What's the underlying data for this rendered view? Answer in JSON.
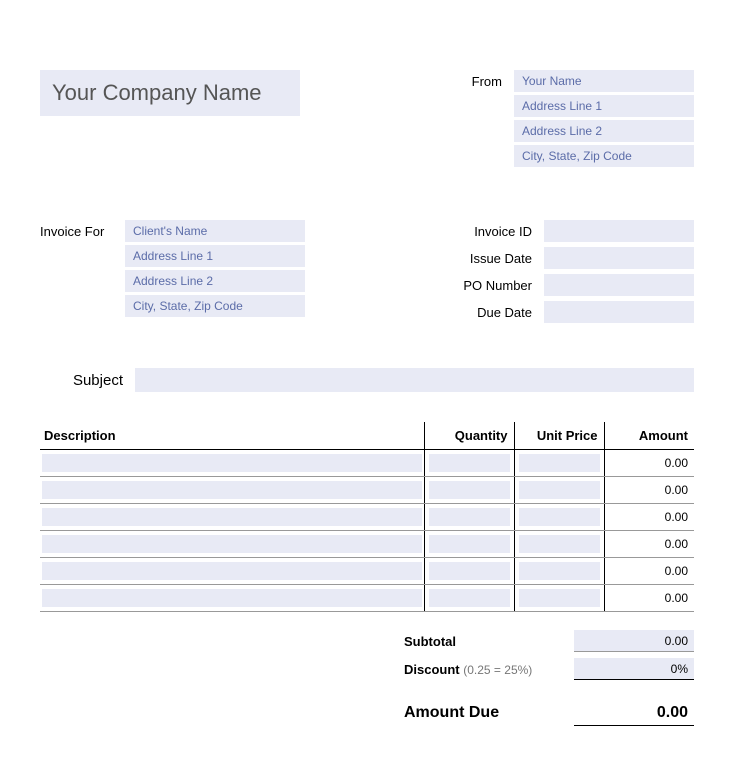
{
  "company": {
    "name_placeholder": "Your Company Name"
  },
  "from": {
    "label": "From",
    "name": "Your Name",
    "addr1": "Address Line 1",
    "addr2": "Address Line 2",
    "city": "City, State, Zip Code"
  },
  "invoice_for": {
    "label": "Invoice For",
    "name": "Client's Name",
    "addr1": "Address Line 1",
    "addr2": "Address Line 2",
    "city": "City, State, Zip Code"
  },
  "meta": {
    "invoice_id_label": "Invoice ID",
    "issue_date_label": "Issue Date",
    "po_number_label": "PO Number",
    "due_date_label": "Due Date"
  },
  "subject": {
    "label": "Subject"
  },
  "table": {
    "headers": {
      "description": "Description",
      "quantity": "Quantity",
      "unit_price": "Unit Price",
      "amount": "Amount"
    },
    "rows": [
      {
        "amount": "0.00"
      },
      {
        "amount": "0.00"
      },
      {
        "amount": "0.00"
      },
      {
        "amount": "0.00"
      },
      {
        "amount": "0.00"
      },
      {
        "amount": "0.00"
      }
    ]
  },
  "totals": {
    "subtotal_label": "Subtotal",
    "subtotal_value": "0.00",
    "discount_label": "Discount",
    "discount_hint": "(0.25 = 25%)",
    "discount_value": "0%",
    "amount_due_label": "Amount Due",
    "amount_due_value": "0.00"
  }
}
